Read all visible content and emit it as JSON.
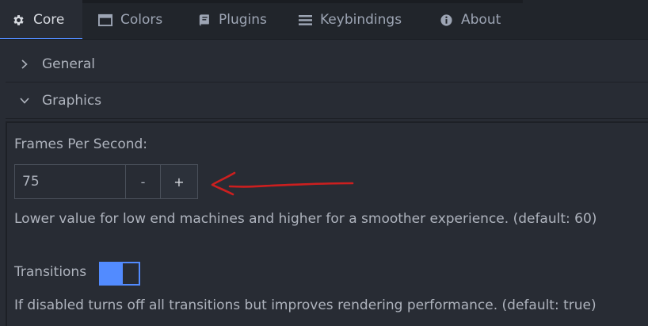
{
  "tabs": [
    {
      "label": "Core",
      "icon": "gear-icon",
      "active": true
    },
    {
      "label": "Colors",
      "icon": "window-icon",
      "active": false
    },
    {
      "label": "Plugins",
      "icon": "book-icon",
      "active": false
    },
    {
      "label": "Keybindings",
      "icon": "menu-icon",
      "active": false
    },
    {
      "label": "About",
      "icon": "info-icon",
      "active": false
    }
  ],
  "sections": {
    "general": {
      "label": "General",
      "expanded": false
    },
    "graphics": {
      "label": "Graphics",
      "expanded": true
    }
  },
  "fps": {
    "label": "Frames Per Second:",
    "value": "75",
    "decrement_label": "-",
    "increment_label": "+",
    "description": "Lower value for low end machines and higher for a smoother experience. (default: 60)"
  },
  "transitions": {
    "label": "Transitions",
    "enabled": true,
    "description": "If disabled turns off all transitions but improves rendering performance. (default: true)"
  },
  "colors": {
    "accent": "#528bff",
    "annotation_arrow": "#cc1f1f"
  }
}
